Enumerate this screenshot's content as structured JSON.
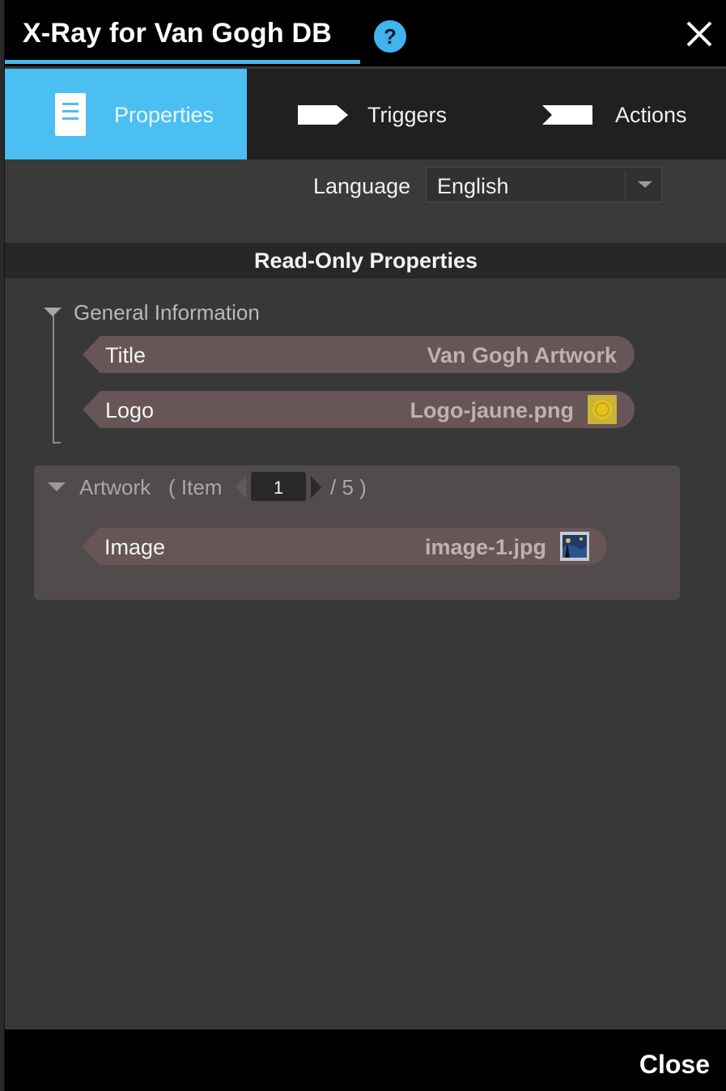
{
  "window": {
    "title": "X-Ray for Van Gogh DB",
    "help_icon": "?"
  },
  "tabs": [
    {
      "label": "Properties",
      "icon": "document-icon",
      "active": true
    },
    {
      "label": "Triggers",
      "icon": "arrow-right-icon",
      "active": false
    },
    {
      "label": "Actions",
      "icon": "arrow-notch-icon",
      "active": false
    }
  ],
  "language": {
    "label": "Language",
    "selected": "English"
  },
  "section": {
    "title": "Read-Only Properties"
  },
  "general": {
    "title": "General Information",
    "properties": [
      {
        "name": "Title",
        "value": "Van Gogh Artwork"
      },
      {
        "name": "Logo",
        "value": "Logo-jaune.png",
        "thumb": "yellow-logo-thumb"
      }
    ]
  },
  "artwork": {
    "title": "Artwork",
    "item_prefix": "( Item",
    "current_item": "1",
    "total_suffix": "/ 5 )",
    "properties": [
      {
        "name": "Image",
        "value": "image-1.jpg",
        "thumb": "starry-night-thumb"
      }
    ]
  },
  "footer": {
    "close_label": "Close"
  },
  "colors": {
    "accent": "#4bbff2",
    "property_bg": "#675557",
    "panel_bg": "#524b4c"
  }
}
